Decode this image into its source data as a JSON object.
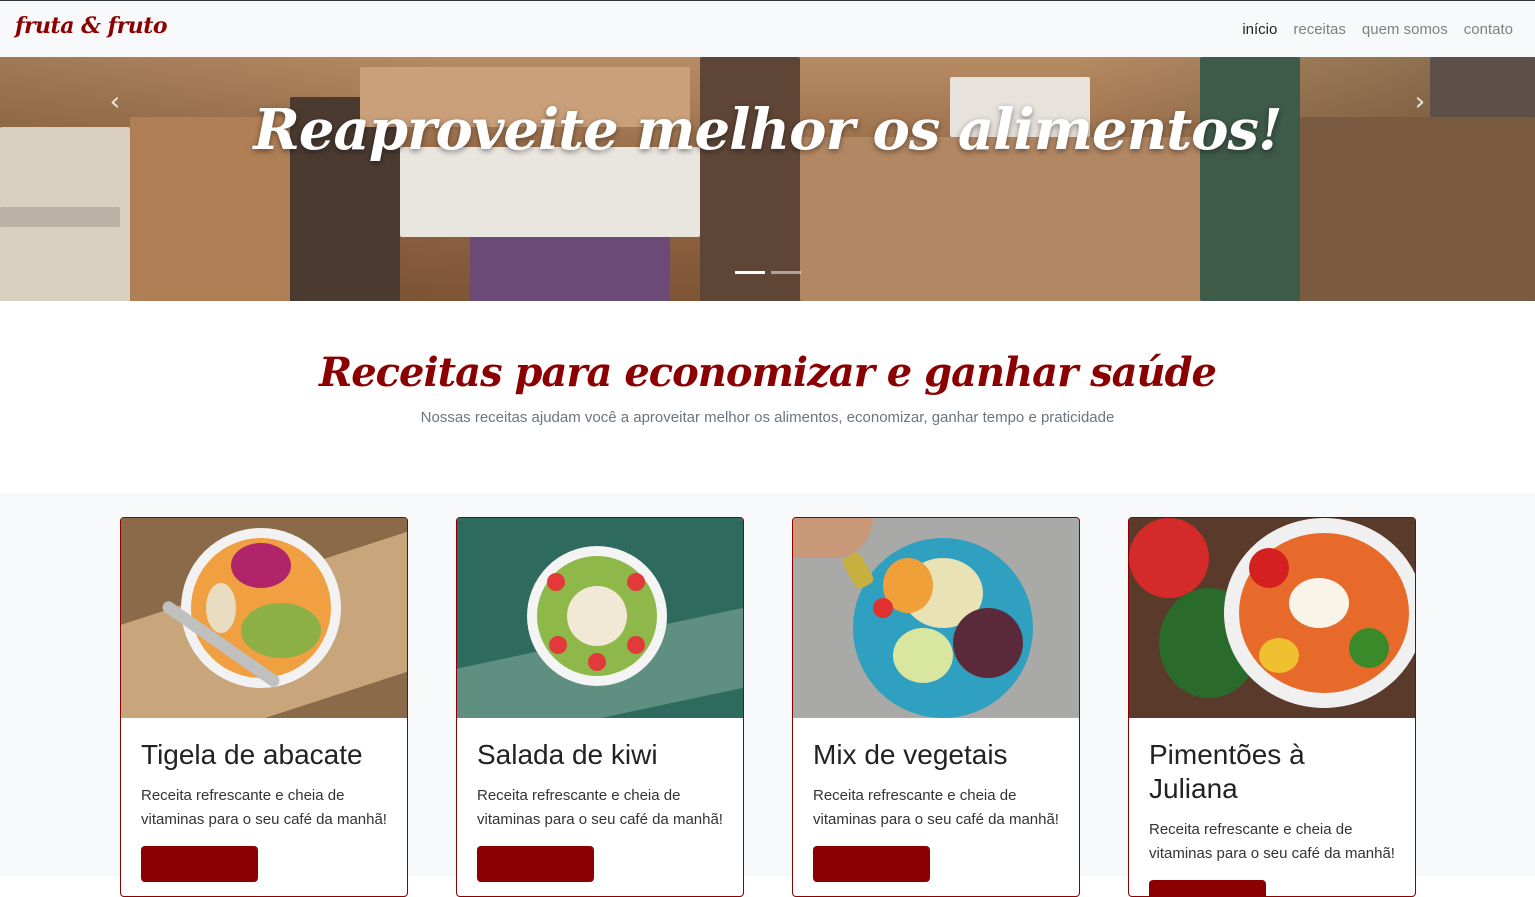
{
  "nav": {
    "brand": "fruta & fruto",
    "links": [
      "início",
      "receitas",
      "quem somos",
      "contato"
    ]
  },
  "hero": {
    "caption": "Reaproveite melhor os alimentos!",
    "prev_icon": "‹",
    "next_icon": "›"
  },
  "intro": {
    "title": "Receitas para economizar e ganhar saúde",
    "subtitle": "Nossas receitas ajudam você a aproveitar melhor os alimentos, economizar, ganhar tempo e praticidade"
  },
  "cards": [
    {
      "title": "Tigela de abacate",
      "text": "Receita refrescante e cheia de vitaminas para o seu café da manhã!"
    },
    {
      "title": "Salada de kiwi",
      "text": "Receita refrescante e cheia de vitaminas para o seu café da manhã!"
    },
    {
      "title": "Mix de vegetais",
      "text": "Receita refrescante e cheia de vitaminas para o seu café da manhã!"
    },
    {
      "title": "Pimentões à Juliana",
      "text": "Receita refrescante e cheia de vitaminas para o seu café da manhã!"
    }
  ],
  "colors": {
    "brand": "#8b0000",
    "navbar_bg": "#f8f9fa",
    "muted_text": "#6c757d"
  }
}
